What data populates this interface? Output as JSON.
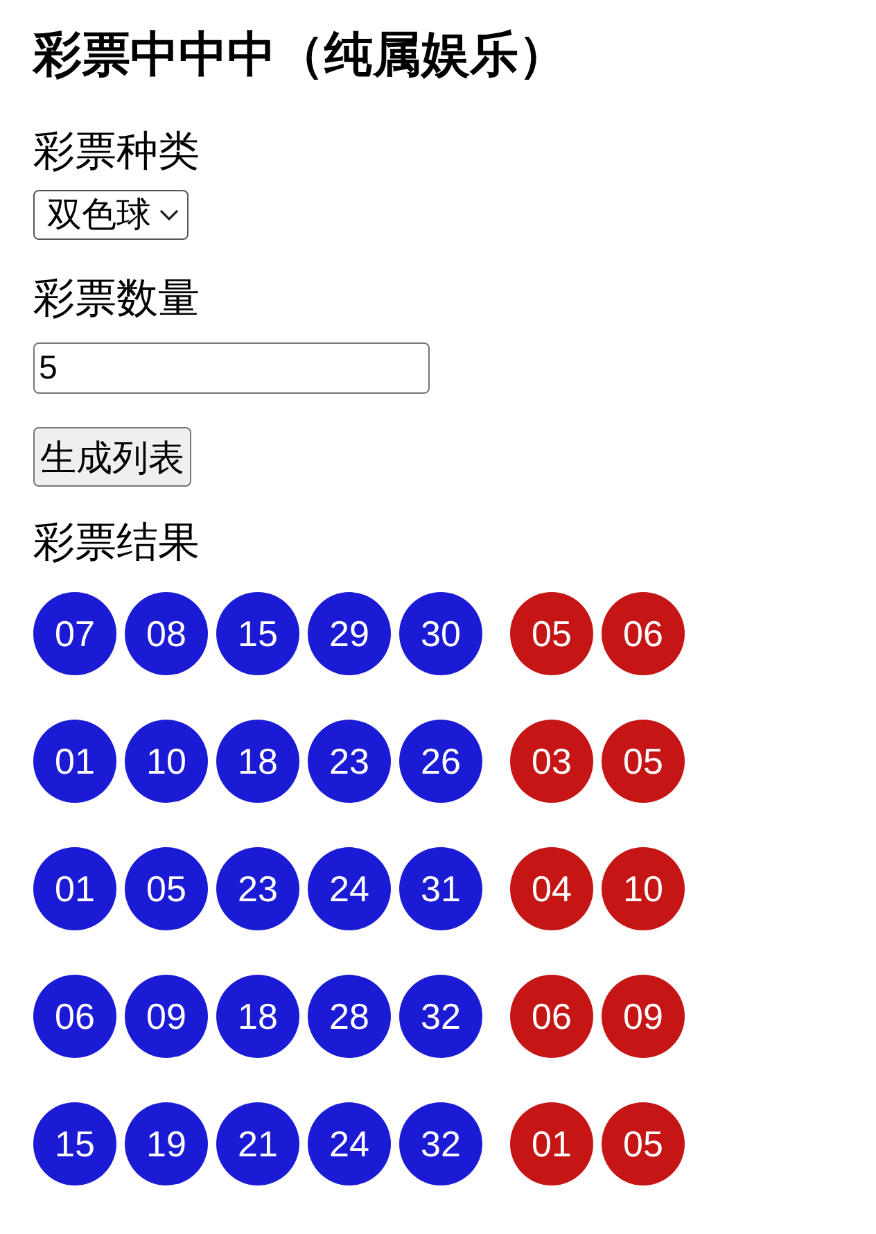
{
  "title": "彩票中中中（纯属娱乐）",
  "lottery_type": {
    "label": "彩票种类",
    "value": "双色球"
  },
  "quantity": {
    "label": "彩票数量",
    "value": "5"
  },
  "generate_button": "生成列表",
  "results": {
    "label": "彩票结果",
    "rows": [
      {
        "groups": [
          {
            "color": "#1b1bd6",
            "numbers": [
              "07",
              "08",
              "15",
              "29",
              "30"
            ]
          },
          {
            "color": "#c51515",
            "numbers": [
              "05",
              "06"
            ]
          }
        ]
      },
      {
        "groups": [
          {
            "color": "#1b1bd6",
            "numbers": [
              "01",
              "10",
              "18",
              "23",
              "26"
            ]
          },
          {
            "color": "#c51515",
            "numbers": [
              "03",
              "05"
            ]
          }
        ]
      },
      {
        "groups": [
          {
            "color": "#1b1bd6",
            "numbers": [
              "01",
              "05",
              "23",
              "24",
              "31"
            ]
          },
          {
            "color": "#c51515",
            "numbers": [
              "04",
              "10"
            ]
          }
        ]
      },
      {
        "groups": [
          {
            "color": "#1b1bd6",
            "numbers": [
              "06",
              "09",
              "18",
              "28",
              "32"
            ]
          },
          {
            "color": "#c51515",
            "numbers": [
              "06",
              "09"
            ]
          }
        ]
      },
      {
        "groups": [
          {
            "color": "#1b1bd6",
            "numbers": [
              "15",
              "19",
              "21",
              "24",
              "32"
            ]
          },
          {
            "color": "#c51515",
            "numbers": [
              "01",
              "05"
            ]
          }
        ]
      }
    ]
  }
}
